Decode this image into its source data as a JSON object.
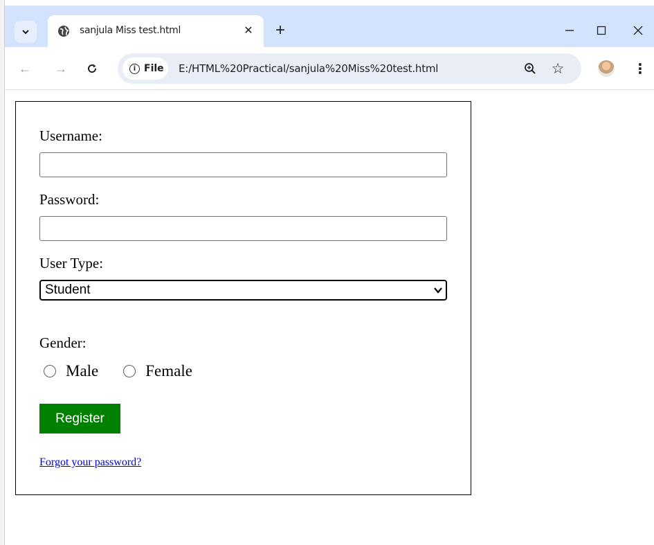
{
  "browser": {
    "tab_search_icon": "chevron-down-icon",
    "tab": {
      "title": "sanjula Miss test.html",
      "favicon": "globe-icon",
      "close_glyph": "✕"
    },
    "new_tab_glyph": "+",
    "window_controls": {
      "minimize": "—",
      "maximize": "☐",
      "close": "✕"
    },
    "toolbar": {
      "back_glyph": "←",
      "forward_glyph": "→",
      "reload_glyph": "C",
      "site_chip_label": "File",
      "url": "E:/HTML%20Practical/sanjula%20Miss%20test.html",
      "zoom_icon": "zoom-in-icon",
      "bookmark_glyph": "☆",
      "menu_glyph": "⋮"
    }
  },
  "form": {
    "username_label": "Username:",
    "username_value": "",
    "password_label": "Password:",
    "password_value": "",
    "user_type_label": "User Type:",
    "user_type_selected": "Student",
    "gender_label": "Gender:",
    "gender_options": [
      "Male",
      "Female"
    ],
    "register_label": "Register",
    "forgot_link": "Forgot your password?"
  },
  "colors": {
    "tabstrip_bg": "#d3e3fd",
    "omnibox_bg": "#e9eef6",
    "register_bg": "#008000",
    "link_color": "#0000ee"
  }
}
